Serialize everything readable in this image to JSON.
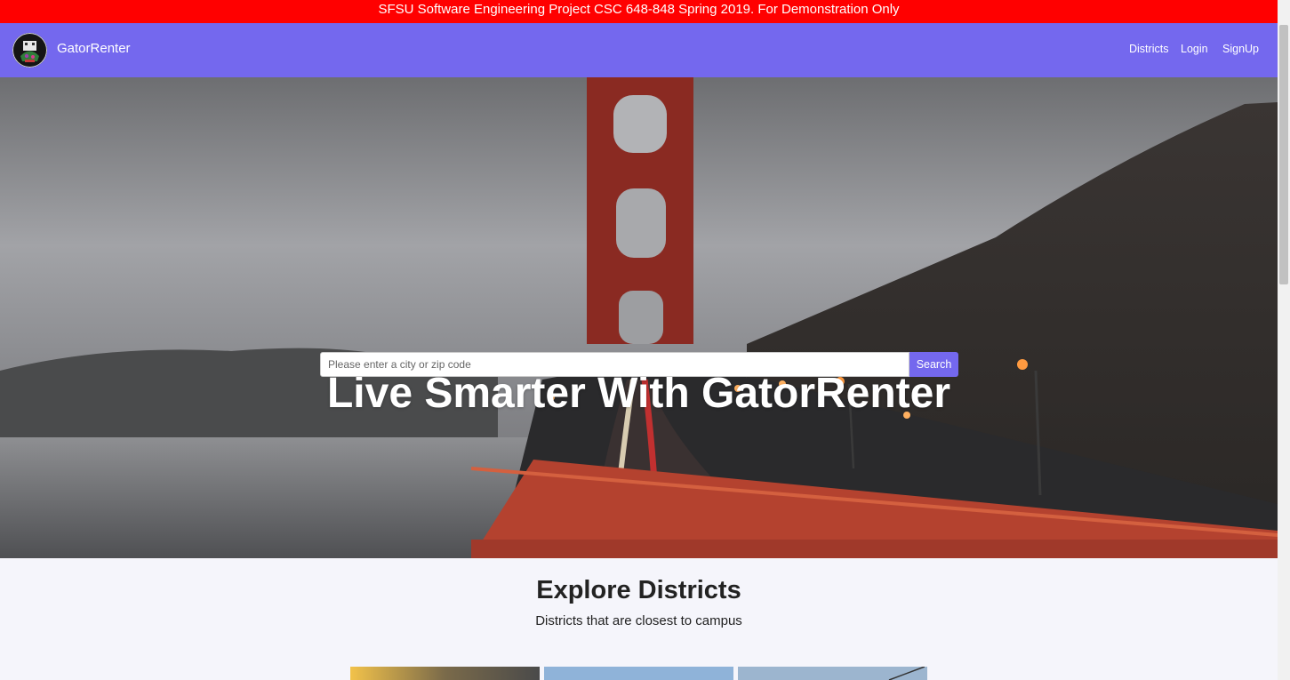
{
  "banner": {
    "text": "SFSU Software Engineering Project CSC 648-848 Spring 2019. For Demonstration Only"
  },
  "navbar": {
    "brand": "GatorRenter",
    "logo_icon": "gator-logo-icon",
    "links": [
      {
        "label": "Districts"
      },
      {
        "label": "Login"
      },
      {
        "label": "SignUp"
      }
    ]
  },
  "hero": {
    "title": "Live Smarter With GatorRenter",
    "background": "golden-gate-bridge-photo",
    "search": {
      "value": "",
      "placeholder": "Please enter a city or zip code",
      "button_label": "Search"
    }
  },
  "districts": {
    "title": "Explore Districts",
    "subtitle": "Districts that are closest to campus",
    "cards": [
      {
        "image": "district-photo-1"
      },
      {
        "image": "district-photo-2"
      },
      {
        "image": "district-photo-3"
      }
    ]
  },
  "colors": {
    "banner_bg": "#ff0000",
    "accent": "#7468ee",
    "page_bg": "#f5f5fb"
  }
}
